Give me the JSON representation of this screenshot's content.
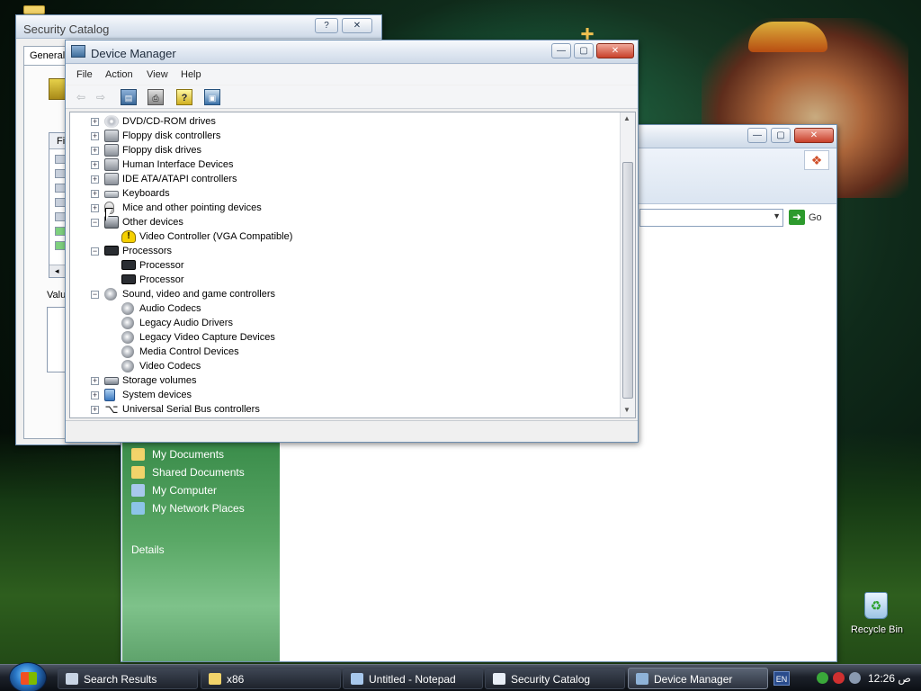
{
  "desktop": {
    "recycle_bin_label": "Recycle Bin"
  },
  "security_catalog": {
    "title": "Security Catalog",
    "help_glyph": "?",
    "close_glyph": "✕",
    "tab_label": "General",
    "list_header": "Fie",
    "value_label": "Valu",
    "scroll_left_glyph": "◂"
  },
  "explorer": {
    "go_label": "Go",
    "xp_logo_glyph": "❖",
    "go_arrow_glyph": "➜",
    "dropdown_glyph": "▼",
    "min_glyph": "—",
    "max_glyph": "▢",
    "close_glyph": "✕",
    "sidebar": {
      "items": [
        {
          "label": "My Documents",
          "icon": "folder-doc-icon",
          "color": "#f2d36a"
        },
        {
          "label": "Shared Documents",
          "icon": "folder-icon",
          "color": "#f2d36a"
        },
        {
          "label": "My Computer",
          "icon": "computer-icon",
          "color": "#a8c8ec"
        },
        {
          "label": "My Network Places",
          "icon": "network-icon",
          "color": "#8cc4e8"
        }
      ],
      "details_label": "Details"
    }
  },
  "device_manager": {
    "title": "Device Manager",
    "min_glyph": "—",
    "max_glyph": "▢",
    "close_glyph": "✕",
    "menu": [
      "File",
      "Action",
      "View",
      "Help"
    ],
    "toolbar": {
      "back_glyph": "⇦",
      "forward_glyph": "⇨",
      "properties_glyph": "▤",
      "print_glyph": "⎙",
      "help_glyph": "?",
      "monitor_glyph": "▣"
    },
    "scroll_up_glyph": "▲",
    "scroll_down_glyph": "▼",
    "tree": [
      {
        "label": "DVD/CD-ROM drives",
        "level": 0,
        "expander": "+",
        "icon": "dvd-drive-icon"
      },
      {
        "label": "Floppy disk controllers",
        "level": 0,
        "expander": "+",
        "icon": "controller-icon"
      },
      {
        "label": "Floppy disk drives",
        "level": 0,
        "expander": "+",
        "icon": "floppy-drive-icon"
      },
      {
        "label": "Human Interface Devices",
        "level": 0,
        "expander": "+",
        "icon": "hid-icon"
      },
      {
        "label": "IDE ATA/ATAPI controllers",
        "level": 0,
        "expander": "+",
        "icon": "ide-controller-icon"
      },
      {
        "label": "Keyboards",
        "level": 0,
        "expander": "+",
        "icon": "keyboard-icon"
      },
      {
        "label": "Mice and other pointing devices",
        "level": 0,
        "expander": "+",
        "icon": "mouse-icon"
      },
      {
        "label": "Other devices",
        "level": 0,
        "expander": "−",
        "icon": "other-devices-icon"
      },
      {
        "label": "Video Controller (VGA Compatible)",
        "level": 1,
        "expander": "",
        "icon": "warning-device-icon"
      },
      {
        "label": "Processors",
        "level": 0,
        "expander": "−",
        "icon": "processor-icon"
      },
      {
        "label": "Processor",
        "level": 1,
        "expander": "",
        "icon": "processor-icon"
      },
      {
        "label": "Processor",
        "level": 1,
        "expander": "",
        "icon": "processor-icon"
      },
      {
        "label": "Sound, video and game controllers",
        "level": 0,
        "expander": "−",
        "icon": "sound-icon"
      },
      {
        "label": "Audio Codecs",
        "level": 1,
        "expander": "",
        "icon": "sound-icon"
      },
      {
        "label": "Legacy Audio Drivers",
        "level": 1,
        "expander": "",
        "icon": "sound-icon"
      },
      {
        "label": "Legacy Video Capture Devices",
        "level": 1,
        "expander": "",
        "icon": "sound-icon"
      },
      {
        "label": "Media Control Devices",
        "level": 1,
        "expander": "",
        "icon": "sound-icon"
      },
      {
        "label": "Video Codecs",
        "level": 1,
        "expander": "",
        "icon": "sound-icon"
      },
      {
        "label": "Storage volumes",
        "level": 0,
        "expander": "+",
        "icon": "storage-icon"
      },
      {
        "label": "System devices",
        "level": 0,
        "expander": "+",
        "icon": "system-device-icon"
      },
      {
        "label": "Universal Serial Bus controllers",
        "level": 0,
        "expander": "+",
        "icon": "usb-icon"
      }
    ]
  },
  "taskbar": {
    "tasks": [
      {
        "label": "Search Results",
        "icon": "search-results-icon",
        "color": "#c8d4e4"
      },
      {
        "label": "x86",
        "icon": "folder-icon",
        "color": "#f2d36a"
      },
      {
        "label": "Untitled - Notepad",
        "icon": "notepad-icon",
        "color": "#a8c8ec"
      },
      {
        "label": "Security Catalog",
        "icon": "security-catalog-icon",
        "color": "#e8eef6"
      },
      {
        "label": "Device Manager",
        "icon": "device-manager-icon",
        "color": "#8fb3d8"
      }
    ],
    "language": "EN",
    "clock": "12:26 ص"
  }
}
